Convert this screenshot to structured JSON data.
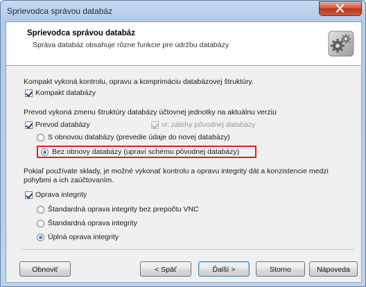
{
  "window": {
    "title": "Sprievodca správou databáz"
  },
  "header": {
    "title": "Sprievodca správou databáz",
    "subtitle": "Správa databáz obsahuje rôzne funkcie pre údržbu databázy"
  },
  "compact": {
    "description": "Kompakt vykoná kontrolu, opravu a komprimáciu databázovej štruktúry.",
    "checkbox_label": "Kompakt databázy",
    "checked": true
  },
  "conversion": {
    "description": "Prevod vykoná zmenu štruktúry databázy účtovnej jednotky na aktuálnu verziu",
    "checkbox_label": "Prevod databázy",
    "checked": true,
    "backup_label": "vr. zálohy pôvodnej databázy",
    "backup_checked": true,
    "backup_enabled": false,
    "option_restore": "S obnovou databázy (prevedie údaje do novej databázy)",
    "option_no_restore": "Bez obnovy databázy (upraví schému pôvodnej databázy)",
    "selected": "no_restore"
  },
  "integrity": {
    "description": "Pokiaľ používate sklady, je možné vykonať kontrolu a opravu integrity dát a konzistencie medzi pohybmi a ich zaúčtovaním.",
    "checkbox_label": "Oprava integrity",
    "checked": true,
    "option_standard_no_vnc": "Štandardná oprava integrity bez prepočtu VNC",
    "option_standard": "Štandardná oprava integrity",
    "option_full": "Úplná oprava integrity",
    "selected": "full"
  },
  "buttons": {
    "refresh": "Obnoviť",
    "back": "< Späť",
    "next": "Ďalší >",
    "cancel": "Storno",
    "help": "Nápoveda"
  },
  "colors": {
    "highlight_border": "#e0201c",
    "title_bar": "#b3cbe7",
    "close_button": "#c9472c"
  },
  "icons": {
    "header": "gear-cog-icon",
    "close": "close-icon"
  }
}
